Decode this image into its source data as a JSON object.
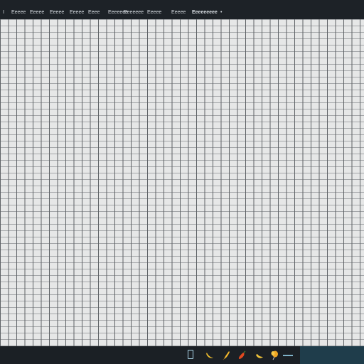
{
  "menubar": {
    "items": [
      "I",
      "Eeeee",
      "Eeeee",
      "Eeeee",
      "Eeeee",
      "Eeee",
      "Eeeeeee",
      "Eeeeeee",
      "Eeeee",
      "Eeeeeeeee"
    ],
    "extra_glyph": "•"
  },
  "taskbar": {
    "icons": [
      "window-icon",
      "banana-icon",
      "banana-icon",
      "pepper-icon",
      "banana-icon",
      "balloon-icon",
      "minimize-icon"
    ]
  },
  "colors": {
    "menubar_bg": "#1d2227",
    "grid_bg": "#e6e7e7",
    "grid_line": "#5e6266",
    "taskbar_bg": "#1b2025",
    "taskbar_accent": "#1f3d4b"
  }
}
